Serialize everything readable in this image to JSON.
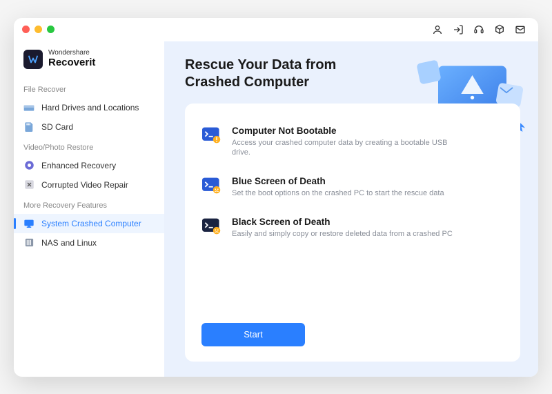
{
  "brand": {
    "line1": "Wondershare",
    "line2": "Recoverit"
  },
  "sidebar": {
    "sections": [
      {
        "label": "File Recover",
        "items": [
          {
            "icon": "drive-icon",
            "label": "Hard Drives and Locations"
          },
          {
            "icon": "sdcard-icon",
            "label": "SD Card"
          }
        ]
      },
      {
        "label": "Video/Photo Restore",
        "items": [
          {
            "icon": "enhanced-icon",
            "label": "Enhanced Recovery"
          },
          {
            "icon": "repair-icon",
            "label": "Corrupted Video Repair"
          }
        ]
      },
      {
        "label": "More Recovery Features",
        "items": [
          {
            "icon": "monitor-icon",
            "label": "System Crashed Computer",
            "active": true
          },
          {
            "icon": "nas-icon",
            "label": "NAS and Linux"
          }
        ]
      }
    ]
  },
  "main": {
    "title": "Rescue Your Data from Crashed Computer",
    "options": [
      {
        "title": "Computer Not Bootable",
        "desc": "Access your crashed computer data by creating a bootable USB drive."
      },
      {
        "title": "Blue Screen of Death",
        "desc": "Set the boot options on the crashed PC to start the rescue data"
      },
      {
        "title": "Black Screen of Death",
        "desc": "Easily and simply copy or restore deleted data from a crashed PC"
      }
    ],
    "start_label": "Start"
  }
}
